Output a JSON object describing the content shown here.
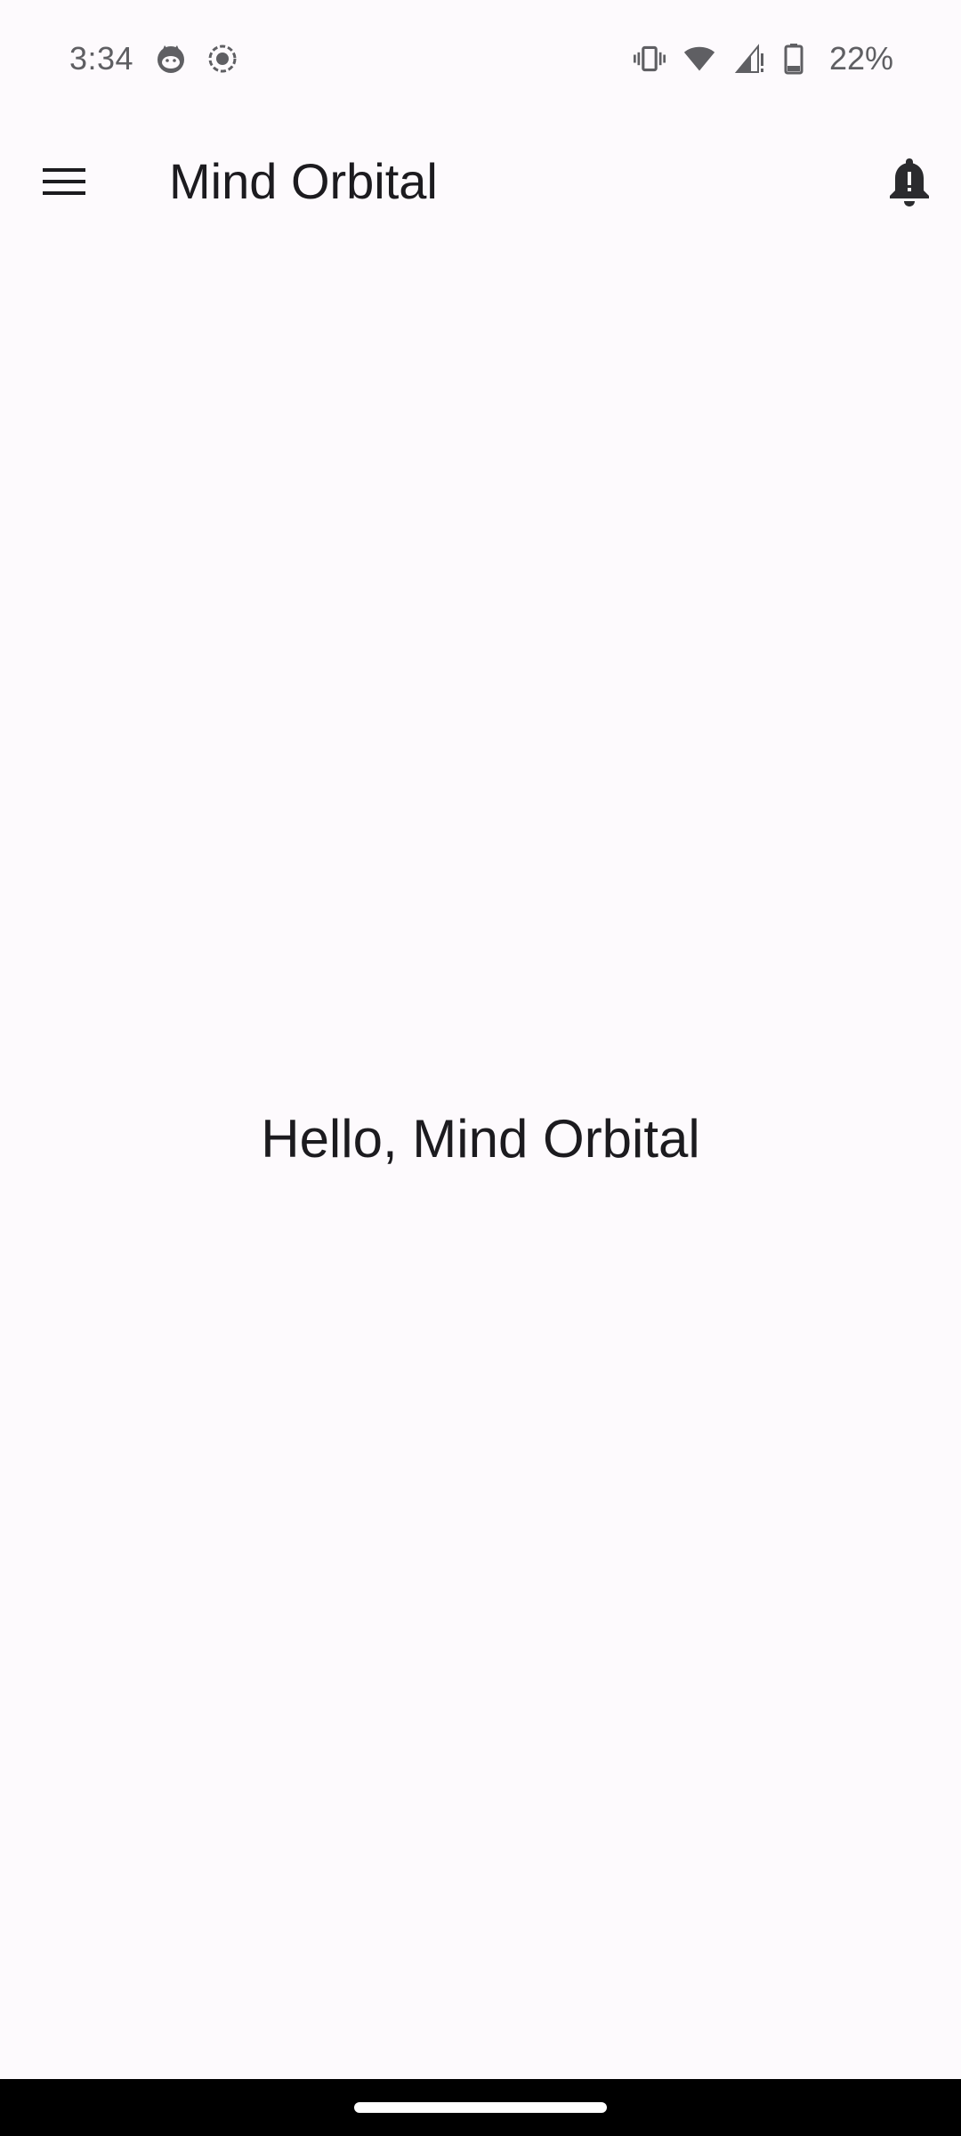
{
  "status_bar": {
    "time": "3:34",
    "left_icons": [
      "cat-face-icon",
      "screen-record-icon"
    ],
    "right_icons": [
      "vibrate-icon",
      "wifi-icon",
      "cell-signal-icon",
      "battery-icon"
    ],
    "battery_percent": "22%"
  },
  "app_bar": {
    "title": "Mind Orbital",
    "menu_icon": "hamburger-menu-icon",
    "action_icon": "notification-bell-icon"
  },
  "main": {
    "greeting": "Hello, Mind Orbital"
  },
  "colors": {
    "background": "#fdfafd",
    "text": "#1c1b1f",
    "status_text": "#5f5f63",
    "nav_bar": "#000000"
  }
}
